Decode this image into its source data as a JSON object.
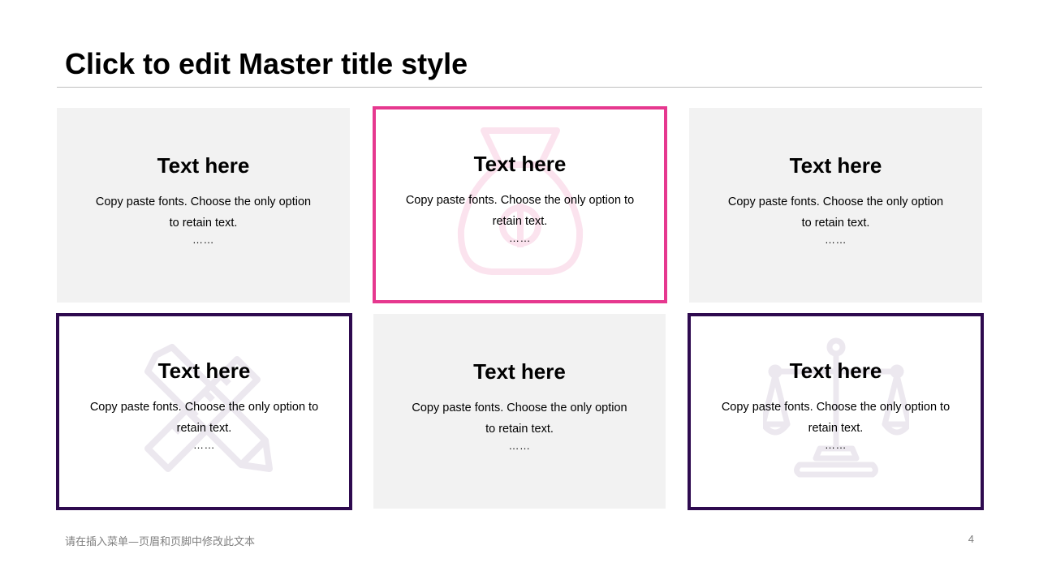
{
  "slide": {
    "title": "Click to edit Master title style",
    "footer_text": "请在插入菜单—页眉和页脚中修改此文本",
    "page_number": "4"
  },
  "colors": {
    "accent_pink": "#e6388f",
    "accent_purple": "#2e0a4f",
    "card_grey": "#f2f2f2"
  },
  "cards": [
    {
      "heading": "Text here",
      "body": "Copy paste fonts. Choose the only option to retain text.",
      "ellipsis": "……",
      "style": "grey",
      "icon": ""
    },
    {
      "heading": "Text here",
      "body": "Copy paste fonts. Choose the only option to retain text.",
      "ellipsis": "……",
      "style": "pink-outline",
      "icon": "money-bag-icon"
    },
    {
      "heading": "Text here",
      "body": "Copy paste fonts. Choose the only option to retain text.",
      "ellipsis": "……",
      "style": "grey",
      "icon": ""
    },
    {
      "heading": "Text here",
      "body": "Copy paste fonts. Choose the only option to retain text.",
      "ellipsis": "……",
      "style": "purple-outline",
      "icon": "ruler-pencil-icon"
    },
    {
      "heading": "Text here",
      "body": "Copy paste fonts. Choose the only option to retain text.",
      "ellipsis": "……",
      "style": "grey",
      "icon": ""
    },
    {
      "heading": "Text here",
      "body": "Copy paste fonts. Choose the only option to retain text.",
      "ellipsis": "……",
      "style": "purple-outline",
      "icon": "scales-icon"
    }
  ]
}
